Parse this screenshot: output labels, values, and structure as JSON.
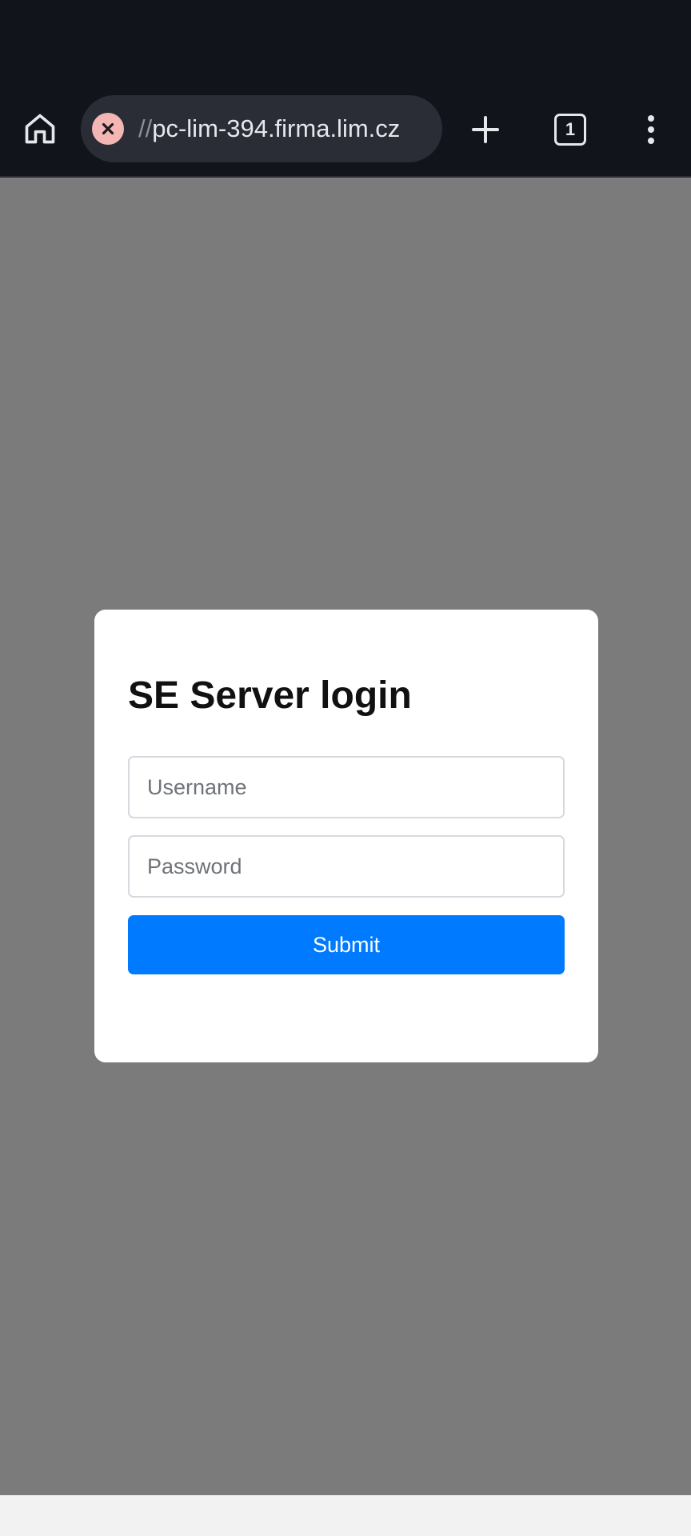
{
  "browser": {
    "url_scheme": "//",
    "url_host": "pc-lim-394.firma.lim.cz",
    "tab_count": "1",
    "icons": {
      "home": "home-icon",
      "security": "not-secure-icon",
      "new_tab": "plus-icon",
      "tabs": "tab-switcher-icon",
      "menu": "more-vert-icon"
    }
  },
  "login": {
    "title": "SE Server login",
    "username_placeholder": "Username",
    "password_placeholder": "Password",
    "submit_label": "Submit"
  },
  "colors": {
    "toolbar_bg": "#12141c",
    "page_bg": "#7b7b7b",
    "accent": "#007bff",
    "security_badge": "#f4b5b5"
  }
}
